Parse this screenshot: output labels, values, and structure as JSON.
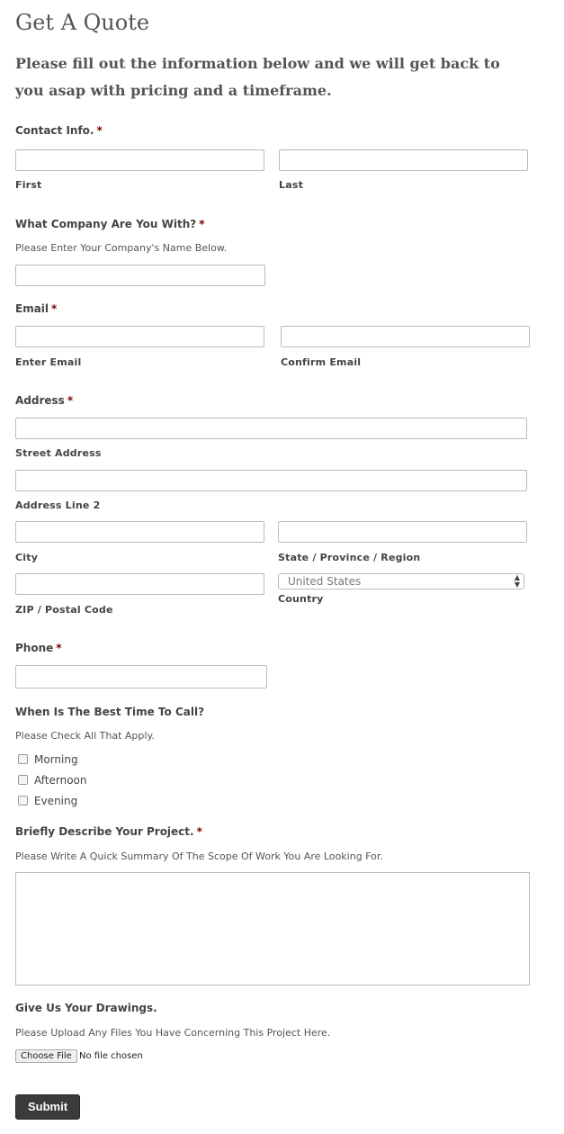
{
  "page_title": "Get A Quote",
  "intro": "Please fill out the information below and we will get back to you asap with pricing and a timeframe.",
  "required_mark": "*",
  "contact": {
    "label": "Contact Info.",
    "first_label": "First",
    "last_label": "Last",
    "first_value": "",
    "last_value": ""
  },
  "company": {
    "label": "What Company Are You With?",
    "description": "Please Enter Your Company's Name Below.",
    "value": ""
  },
  "email": {
    "label": "Email",
    "enter_label": "Enter Email",
    "confirm_label": "Confirm Email",
    "enter_value": "",
    "confirm_value": ""
  },
  "address": {
    "label": "Address",
    "street_label": "Street Address",
    "line2_label": "Address Line 2",
    "city_label": "City",
    "state_label": "State / Province / Region",
    "zip_label": "ZIP / Postal Code",
    "country_label": "Country",
    "country_value": "United States"
  },
  "phone": {
    "label": "Phone",
    "value": ""
  },
  "call_time": {
    "label": "When Is The Best Time To Call?",
    "description": "Please Check All That Apply.",
    "options": [
      "Morning",
      "Afternoon",
      "Evening"
    ]
  },
  "project": {
    "label": "Briefly Describe Your Project.",
    "description": "Please Write A Quick Summary Of The Scope Of Work You Are Looking For.",
    "value": ""
  },
  "drawings": {
    "label": "Give Us Your Drawings.",
    "description": "Please Upload Any Files You Have Concerning This Project Here.",
    "button_label": "Choose File",
    "status": "No file chosen"
  },
  "submit_label": "Submit"
}
